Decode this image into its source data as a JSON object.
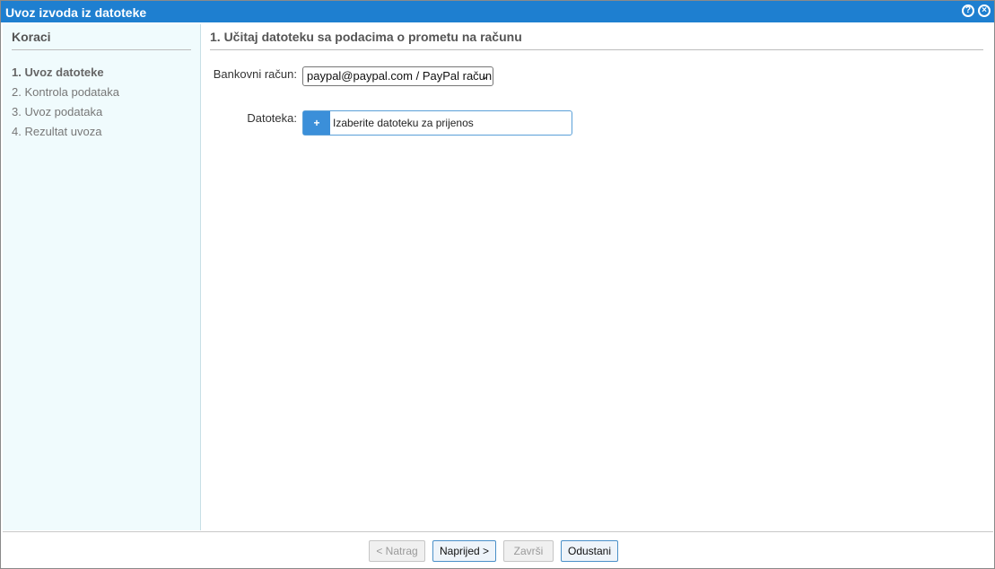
{
  "window": {
    "title": "Uvoz izvoda iz datoteke",
    "help_icon": "help-icon",
    "close_icon": "close-icon"
  },
  "sidebar": {
    "title": "Koraci",
    "steps": [
      {
        "label": "1. Uvoz datoteke",
        "active": true
      },
      {
        "label": "2. Kontrola podataka",
        "active": false
      },
      {
        "label": "3. Uvoz podataka",
        "active": false
      },
      {
        "label": "4. Rezultat uvoza",
        "active": false
      }
    ]
  },
  "main": {
    "title": "1. Učitaj datoteku sa podacima o prometu na računu",
    "bank_account_label": "Bankovni račun:",
    "bank_account_value": "paypal@paypal.com / PayPal račun",
    "file_label": "Datoteka:",
    "file_button_icon": "+",
    "file_placeholder": "Izaberite datoteku za prijenos"
  },
  "footer": {
    "back_label": "< Natrag",
    "next_label": "Naprijed >",
    "finish_label": "Završi",
    "cancel_label": "Odustani"
  },
  "colors": {
    "titlebar": "#1e7fd0",
    "sidebar_bg": "#f0fbfd",
    "accent": "#3b8fd9"
  }
}
